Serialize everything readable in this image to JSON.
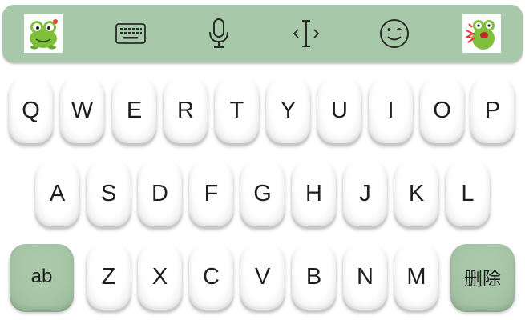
{
  "colors": {
    "toolbar_bg": "#a8c9a9",
    "function_key_bg": "#a6c5a6",
    "key_bg": "#ffffff",
    "key_text": "#1e1e1e"
  },
  "toolbar": {
    "items": [
      {
        "name": "frog-sticker-left",
        "icon": "frog-avatar-icon"
      },
      {
        "name": "keyboard",
        "icon": "keyboard-icon"
      },
      {
        "name": "microphone",
        "icon": "microphone-icon"
      },
      {
        "name": "cursor",
        "icon": "text-cursor-icon"
      },
      {
        "name": "emoji",
        "icon": "wink-emoji-icon"
      },
      {
        "name": "frog-sticker-right",
        "icon": "frog-sticker-icon"
      }
    ]
  },
  "keyboard": {
    "row1": [
      "Q",
      "W",
      "E",
      "R",
      "T",
      "Y",
      "U",
      "I",
      "O",
      "P"
    ],
    "row2": [
      "A",
      "S",
      "D",
      "F",
      "G",
      "H",
      "J",
      "K",
      "L"
    ],
    "row3": [
      "Z",
      "X",
      "C",
      "V",
      "B",
      "N",
      "M"
    ],
    "shift_label": "ab",
    "delete_label": "删除"
  }
}
